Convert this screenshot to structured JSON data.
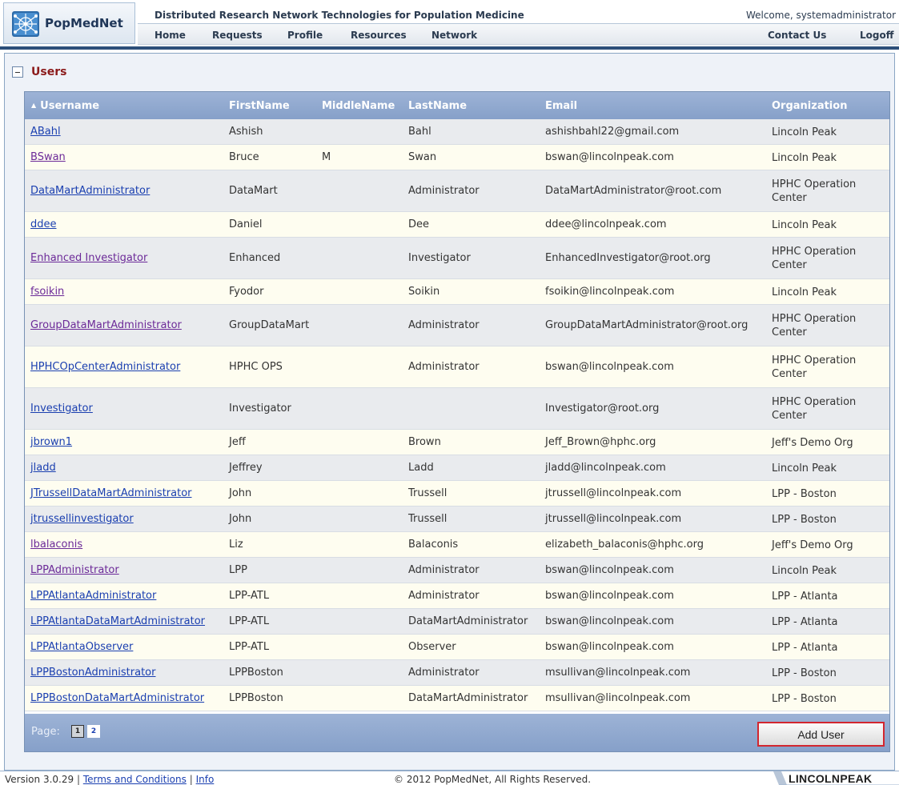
{
  "app": {
    "logo_text": "PopMedNet",
    "title": "Distributed Research Network Technologies for Population Medicine",
    "welcome": "Welcome, systemadministrator"
  },
  "nav": {
    "left": [
      "Home",
      "Requests",
      "Profile",
      "Resources",
      "Network"
    ],
    "right": [
      "Contact Us",
      "Logoff"
    ]
  },
  "section": {
    "title": "Users",
    "collapse_icon": "minus-square-icon"
  },
  "grid": {
    "sort_indicator": "▲",
    "columns": [
      "Username",
      "FirstName",
      "MiddleName",
      "LastName",
      "Email",
      "Organization"
    ],
    "sorted_column": "Username",
    "rows": [
      {
        "username": "ABahl",
        "first": "Ashish",
        "middle": "",
        "last": "Bahl",
        "email": "ashishbahl22@gmail.com",
        "org": "Lincoln Peak",
        "visited": false
      },
      {
        "username": "BSwan",
        "first": "Bruce",
        "middle": "M",
        "last": "Swan",
        "email": "bswan@lincolnpeak.com",
        "org": "Lincoln Peak",
        "visited": true
      },
      {
        "username": "DataMartAdministrator",
        "first": "DataMart",
        "middle": "",
        "last": "Administrator",
        "email": "DataMartAdministrator@root.com",
        "org": "HPHC Operation Center",
        "visited": false
      },
      {
        "username": "ddee",
        "first": "Daniel",
        "middle": "",
        "last": "Dee",
        "email": "ddee@lincolnpeak.com",
        "org": "Lincoln Peak",
        "visited": false
      },
      {
        "username": "Enhanced Investigator",
        "first": "Enhanced",
        "middle": "",
        "last": "Investigator",
        "email": "EnhancedInvestigator@root.org",
        "org": "HPHC Operation Center",
        "visited": true
      },
      {
        "username": "fsoikin",
        "first": "Fyodor",
        "middle": "",
        "last": "Soikin",
        "email": "fsoikin@lincolnpeak.com",
        "org": "Lincoln Peak",
        "visited": true
      },
      {
        "username": "GroupDataMartAdministrator",
        "first": "GroupDataMart",
        "middle": "",
        "last": "Administrator",
        "email": "GroupDataMartAdministrator@root.org",
        "org": "HPHC Operation Center",
        "visited": true
      },
      {
        "username": "HPHCOpCenterAdministrator",
        "first": "HPHC OPS",
        "middle": "",
        "last": "Administrator",
        "email": "bswan@lincolnpeak.com",
        "org": "HPHC Operation Center",
        "visited": false
      },
      {
        "username": "Investigator",
        "first": "Investigator",
        "middle": "",
        "last": "",
        "email": "Investigator@root.org",
        "org": "HPHC Operation Center",
        "visited": false
      },
      {
        "username": "jbrown1",
        "first": "Jeff",
        "middle": "",
        "last": "Brown",
        "email": "Jeff_Brown@hphc.org",
        "org": "Jeff's Demo Org",
        "visited": false
      },
      {
        "username": "jladd",
        "first": "Jeffrey",
        "middle": "",
        "last": "Ladd",
        "email": "jladd@lincolnpeak.com",
        "org": "Lincoln Peak",
        "visited": false
      },
      {
        "username": "JTrussellDataMartAdministrator",
        "first": "John",
        "middle": "",
        "last": "Trussell",
        "email": "jtrussell@lincolnpeak.com",
        "org": "LPP - Boston",
        "visited": false
      },
      {
        "username": "jtrussellinvestigator",
        "first": "John",
        "middle": "",
        "last": "Trussell",
        "email": "jtrussell@lincolnpeak.com",
        "org": "LPP - Boston",
        "visited": false
      },
      {
        "username": "lbalaconis",
        "first": "Liz",
        "middle": "",
        "last": "Balaconis",
        "email": "elizabeth_balaconis@hphc.org",
        "org": "Jeff's Demo Org",
        "visited": true
      },
      {
        "username": "LPPAdministrator",
        "first": "LPP",
        "middle": "",
        "last": "Administrator",
        "email": "bswan@lincolnpeak.com",
        "org": "Lincoln Peak",
        "visited": true
      },
      {
        "username": "LPPAtlantaAdministrator",
        "first": "LPP-ATL",
        "middle": "",
        "last": "Administrator",
        "email": "bswan@lincolnpeak.com",
        "org": "LPP - Atlanta",
        "visited": false
      },
      {
        "username": "LPPAtlantaDataMartAdministrator",
        "first": "LPP-ATL",
        "middle": "",
        "last": "DataMartAdministrator",
        "email": "bswan@lincolnpeak.com",
        "org": "LPP - Atlanta",
        "visited": false
      },
      {
        "username": "LPPAtlantaObserver",
        "first": "LPP-ATL",
        "middle": "",
        "last": "Observer",
        "email": "bswan@lincolnpeak.com",
        "org": "LPP - Atlanta",
        "visited": false
      },
      {
        "username": "LPPBostonAdministrator",
        "first": "LPPBoston",
        "middle": "",
        "last": "Administrator",
        "email": "msullivan@lincolnpeak.com",
        "org": "LPP - Boston",
        "visited": false
      },
      {
        "username": "LPPBostonDataMartAdministrator",
        "first": "LPPBoston",
        "middle": "",
        "last": "DataMartAdministrator",
        "email": "msullivan@lincolnpeak.com",
        "org": "LPP - Boston",
        "visited": false
      }
    ],
    "pager": {
      "label": "Page:",
      "pages": [
        "1",
        "2"
      ],
      "current": "1"
    },
    "add_user_label": "Add User"
  },
  "footer": {
    "version": "Version 3.0.29",
    "separator": "|",
    "terms": "Terms and Conditions",
    "info": "Info",
    "copyright": "© 2012 PopMedNet, All Rights Reserved.",
    "brand": "LINCOLNPEAK"
  },
  "colors": {
    "accent_dark": "#2c4f7a",
    "grid_header": "#8ea7cf",
    "section_title": "#8b1a1a",
    "link": "#1a3fb0",
    "link_visited": "#6c2a98",
    "add_button_border": "#d2262f"
  }
}
